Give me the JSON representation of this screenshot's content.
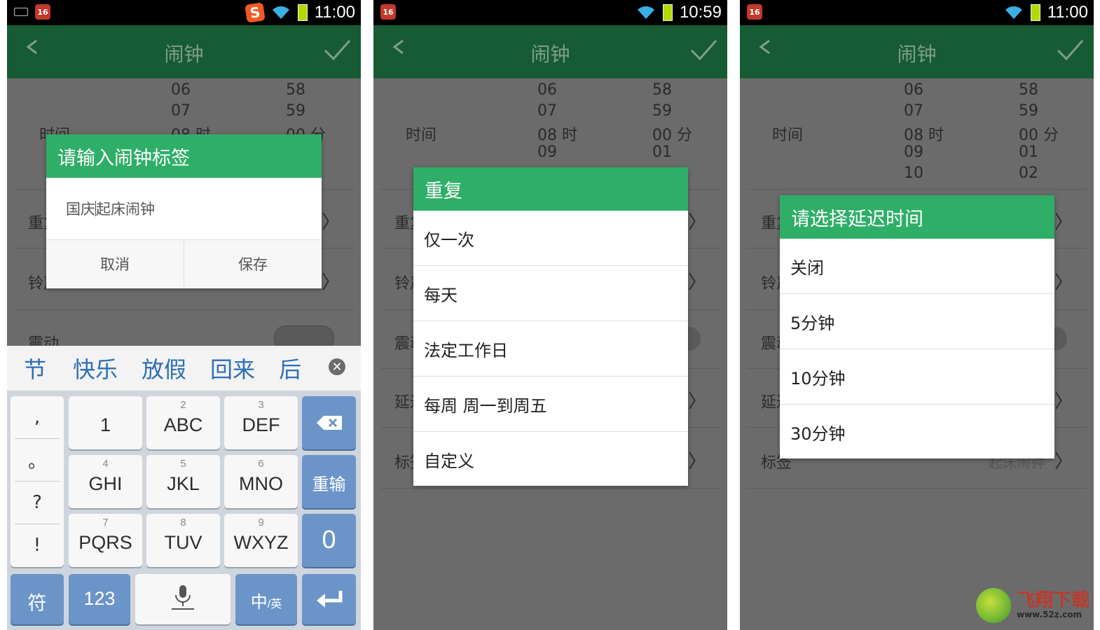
{
  "screens": [
    {
      "status_time": "11:00",
      "title": "闹钟",
      "picker": {
        "hours": [
          "06",
          "07",
          "08 时"
        ],
        "minutes": [
          "58",
          "59",
          "00 分"
        ],
        "time_label": "时间"
      },
      "rows": [
        {
          "label": "重复"
        },
        {
          "label": "铃声"
        },
        {
          "label": "震动"
        }
      ],
      "dialog": {
        "title": "请输入闹钟标签",
        "input_before_caret": "国庆",
        "input_after_caret": "起床闹钟",
        "cancel": "取消",
        "save": "保存"
      },
      "keyboard": {
        "suggestions": [
          "节",
          "快乐",
          "放假",
          "回来",
          "后"
        ],
        "punct": [
          ",",
          "。",
          "?",
          "!"
        ],
        "keys": [
          {
            "sub": "",
            "main": "1"
          },
          {
            "sub": "2",
            "main": "ABC"
          },
          {
            "sub": "3",
            "main": "DEF"
          },
          {
            "sub": "4",
            "main": "GHI"
          },
          {
            "sub": "5",
            "main": "JKL"
          },
          {
            "sub": "6",
            "main": "MNO"
          },
          {
            "sub": "7",
            "main": "PQRS"
          },
          {
            "sub": "8",
            "main": "TUV"
          },
          {
            "sub": "9",
            "main": "WXYZ"
          }
        ],
        "reinput": "重输",
        "zero": "0",
        "symbol": "符",
        "num": "123",
        "lang_main": "中",
        "lang_sub": "/英"
      }
    },
    {
      "status_time": "10:59",
      "title": "闹钟",
      "picker": {
        "time_label": "时间",
        "hours": [
          "06",
          "07",
          "08 时",
          "09"
        ],
        "minutes": [
          "58",
          "59",
          "00 分",
          "01"
        ]
      },
      "row_labels": [
        "重复",
        "铃声",
        "震动",
        "延迟",
        "标签"
      ],
      "dialog": {
        "title": "重复",
        "items": [
          "仅一次",
          "每天",
          "法定工作日",
          "每周 周一到周五",
          "自定义"
        ]
      }
    },
    {
      "status_time": "11:00",
      "title": "闹钟",
      "picker": {
        "time_label": "时间",
        "hours": [
          "06",
          "07",
          "08 时",
          "09",
          "10"
        ],
        "minutes": [
          "58",
          "59",
          "00 分",
          "01",
          "02"
        ]
      },
      "row_labels": [
        "重复",
        "铃声",
        "震动",
        "延迟",
        "标签"
      ],
      "label_value": "起床闹钟",
      "dialog": {
        "title": "请选择延迟时间",
        "items": [
          "关闭",
          "5分钟",
          "10分钟",
          "30分钟"
        ]
      }
    }
  ],
  "watermark": {
    "brand": "飞翔下载",
    "url": "www.52z.com"
  }
}
